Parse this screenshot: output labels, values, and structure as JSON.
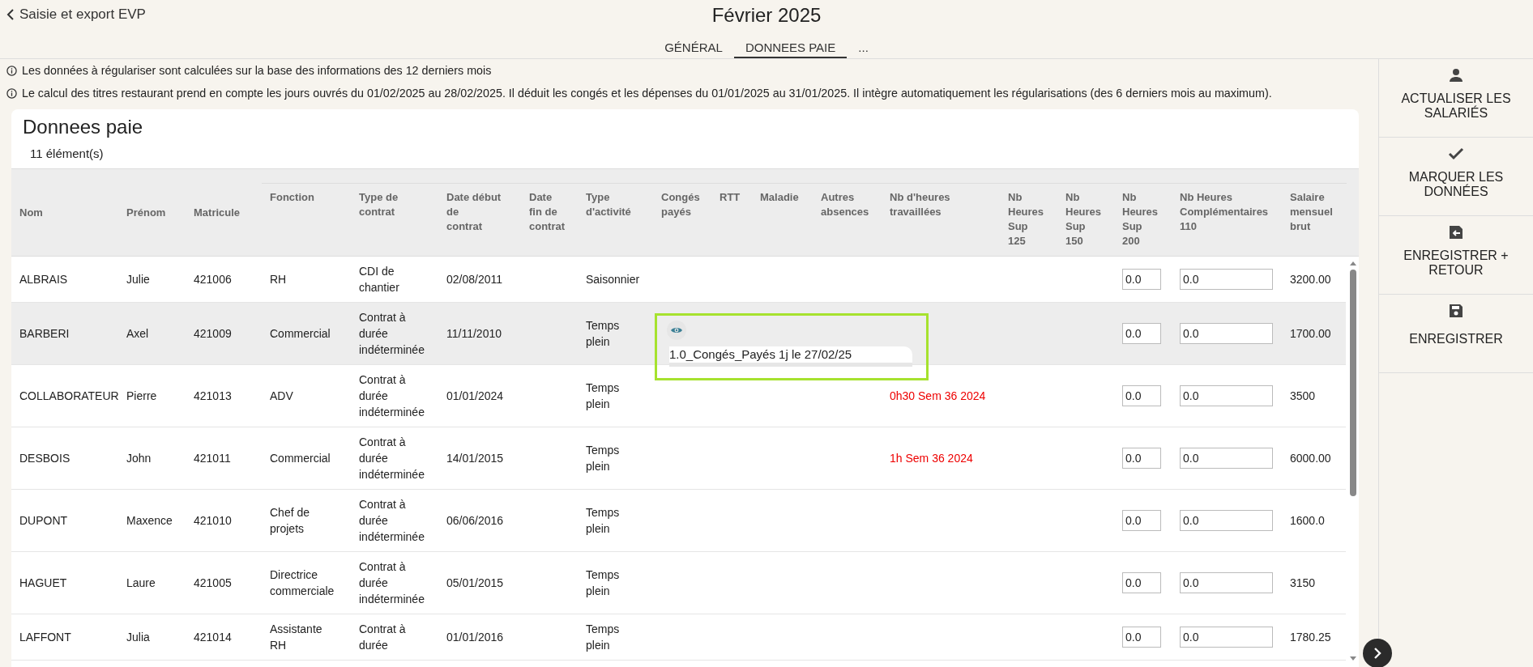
{
  "header": {
    "back_link": "Saisie et export EVP",
    "title": "Février 2025"
  },
  "tabs": [
    {
      "label": "GÉNÉRAL",
      "selected": false
    },
    {
      "label": "DONNEES PAIE",
      "selected": true
    },
    {
      "label": "...",
      "selected": false
    }
  ],
  "notices": [
    "Les données à régulariser sont calculées sur la base des informations des 12 derniers mois",
    "Le calcul des titres restaurant prend en compte les jours ouvrés du 01/02/2025 au 28/02/2025. Il déduit les congés et les dépenses du 01/01/2025 au 31/01/2025. Il intègre automatiquement les régularisations (des 6 derniers mois au maximum)."
  ],
  "table": {
    "title": "Donnees paie",
    "count": "11 élément(s)",
    "columns": [
      {
        "label": "Nom",
        "kind": "text"
      },
      {
        "label": "Prénom",
        "kind": "text"
      },
      {
        "label": "Matricule",
        "kind": "text"
      },
      {
        "label": "Fonction",
        "kind": "text"
      },
      {
        "label": "Type de\ncontrat",
        "kind": "text"
      },
      {
        "label": "Date début\nde\ncontrat",
        "kind": "text"
      },
      {
        "label": "Date\nfin de\ncontrat",
        "kind": "text"
      },
      {
        "label": "Type\nd'activité",
        "kind": "text"
      },
      {
        "label": "Congés\npayés",
        "kind": "text"
      },
      {
        "label": "RTT",
        "kind": "text"
      },
      {
        "label": "Maladie",
        "kind": "text"
      },
      {
        "label": "Autres\nabsences",
        "kind": "text"
      },
      {
        "label": "Nb d'heures\ntravaillées",
        "kind": "text"
      },
      {
        "label": "Nb\nHeures\nSup\n125",
        "kind": "text"
      },
      {
        "label": "Nb\nHeures\nSup\n150",
        "kind": "text"
      },
      {
        "label": "Nb\nHeures\nSup\n200",
        "kind": "input"
      },
      {
        "label": "Nb Heures\nComplémentaires\n110",
        "kind": "input"
      },
      {
        "label": "Salaire\nmensuel\nbrut",
        "kind": "text"
      }
    ],
    "rows": [
      {
        "selected": false,
        "cells": [
          "ALBRAIS",
          "Julie",
          "421006",
          "RH",
          "CDI de\nchantier",
          "02/08/2011",
          null,
          "Saisonnier",
          null,
          null,
          null,
          null,
          null,
          null,
          null,
          "0.0",
          "0.0",
          "3200.00"
        ]
      },
      {
        "selected": true,
        "absence_popup": "1.0_Congés_Payés 1j le 27/02/25",
        "cells": [
          "BARBERI",
          "Axel",
          "421009",
          "Commercial",
          "Contrat à\ndurée\nindéterminée",
          "11/11/2010",
          null,
          "Temps\nplein",
          null,
          null,
          null,
          null,
          null,
          null,
          null,
          "0.0",
          "0.0",
          "1700.00"
        ]
      },
      {
        "selected": false,
        "worked_hours_alert": true,
        "cells": [
          "COLLABORATEUR",
          "Pierre",
          "421013",
          "ADV",
          "Contrat à\ndurée\nindéterminée",
          "01/01/2024",
          null,
          "Temps\nplein",
          null,
          null,
          null,
          null,
          "0h30 Sem 36 2024",
          null,
          null,
          "0.0",
          "0.0",
          "3500"
        ]
      },
      {
        "selected": false,
        "worked_hours_alert": true,
        "cells": [
          "DESBOIS",
          "John",
          "421011",
          "Commercial",
          "Contrat à\ndurée\nindéterminée",
          "14/01/2015",
          null,
          "Temps\nplein",
          null,
          null,
          null,
          null,
          "1h Sem 36 2024",
          null,
          null,
          "0.0",
          "0.0",
          "6000.00"
        ]
      },
      {
        "selected": false,
        "cells": [
          "DUPONT",
          "Maxence",
          "421010",
          "Chef de\nprojets",
          "Contrat à\ndurée\nindéterminée",
          "06/06/2016",
          null,
          "Temps\nplein",
          null,
          null,
          null,
          null,
          null,
          null,
          null,
          "0.0",
          "0.0",
          "1600.0"
        ]
      },
      {
        "selected": false,
        "cells": [
          "HAGUET",
          "Laure",
          "421005",
          "Directrice\ncommerciale",
          "Contrat à\ndurée\nindéterminée",
          "05/01/2015",
          null,
          "Temps\nplein",
          null,
          null,
          null,
          null,
          null,
          null,
          null,
          "0.0",
          "0.0",
          "3150"
        ]
      },
      {
        "selected": false,
        "cells": [
          "LAFFONT",
          "Julia",
          "421014",
          "Assistante\nRH",
          "Contrat à\ndurée",
          "01/01/2016",
          null,
          "Temps\nplein",
          null,
          null,
          null,
          null,
          null,
          null,
          null,
          "0.0",
          "0.0",
          "1780.25"
        ]
      }
    ]
  },
  "actions": [
    {
      "label": "ACTUALISER LES\nSALARIÉS",
      "kind": "person"
    },
    {
      "label": "MARQUER LES\nDONNÉES",
      "kind": "check"
    },
    {
      "label": "ENREGISTRER +\nRETOUR",
      "kind": "save-return"
    },
    {
      "label": "ENREGISTRER",
      "kind": "save"
    }
  ]
}
